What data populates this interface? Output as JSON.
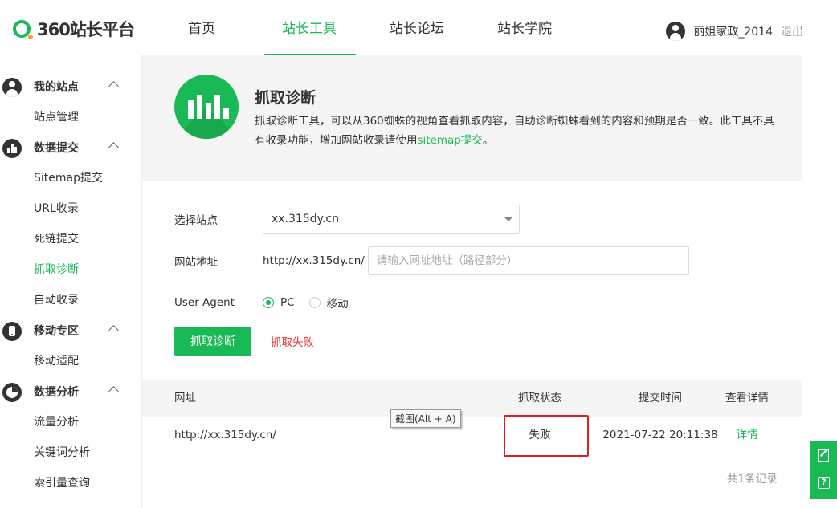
{
  "header": {
    "logo_text": "360站长平台",
    "nav": [
      {
        "label": "首页",
        "active": false
      },
      {
        "label": "站长工具",
        "active": true
      },
      {
        "label": "站长论坛",
        "active": false
      },
      {
        "label": "站长学院",
        "active": false
      }
    ],
    "user_name": "丽姐家政_2014",
    "logout": "退出"
  },
  "sidebar": {
    "groups": [
      {
        "title": "我的站点",
        "icon": "person-icon",
        "items": [
          "站点管理"
        ]
      },
      {
        "title": "数据提交",
        "icon": "bar-chart-icon",
        "items": [
          "Sitemap提交",
          "URL收录",
          "死链提交",
          "抓取诊断",
          "自动收录"
        ]
      },
      {
        "title": "移动专区",
        "icon": "mobile-icon",
        "items": [
          "移动适配"
        ]
      },
      {
        "title": "数据分析",
        "icon": "pie-chart-icon",
        "items": [
          "流量分析",
          "关键词分析",
          "索引量查询"
        ]
      }
    ],
    "active_item": "抓取诊断"
  },
  "banner": {
    "icon": "bar-chart-icon",
    "title": "抓取诊断",
    "desc_prefix": "抓取诊断工具，可以从360蜘蛛的视角查看抓取内容，自助诊断蜘蛛看到的内容和预期是否一致。此工具不具有收录功能，增加网站收录请使用",
    "desc_link": "sitemap提交",
    "desc_suffix": "。"
  },
  "form": {
    "site_label": "选择站点",
    "site_value": "xx.315dy.cn",
    "url_label": "网站地址",
    "url_prefix": "http://xx.315dy.cn/",
    "url_placeholder": "请输入网址地址（路径部分）",
    "ua_label": "User Agent",
    "ua_options": [
      {
        "label": "PC",
        "checked": true
      },
      {
        "label": "移动",
        "checked": false
      }
    ],
    "submit_label": "抓取诊断",
    "fail_message": "抓取失败"
  },
  "table": {
    "headers": {
      "url": "网址",
      "status": "抓取状态",
      "time": "提交时间",
      "detail": "查看详情"
    },
    "rows": [
      {
        "url": "http://xx.315dy.cn/",
        "status": "失败",
        "time": "2021-07-22 20:11:38",
        "detail": "详情"
      }
    ],
    "record_count": "共1条记录"
  },
  "tooltip": "截图(Alt + A)",
  "colors": {
    "brand": "#19b955",
    "error": "#e33333",
    "highlight": "#e02020"
  }
}
